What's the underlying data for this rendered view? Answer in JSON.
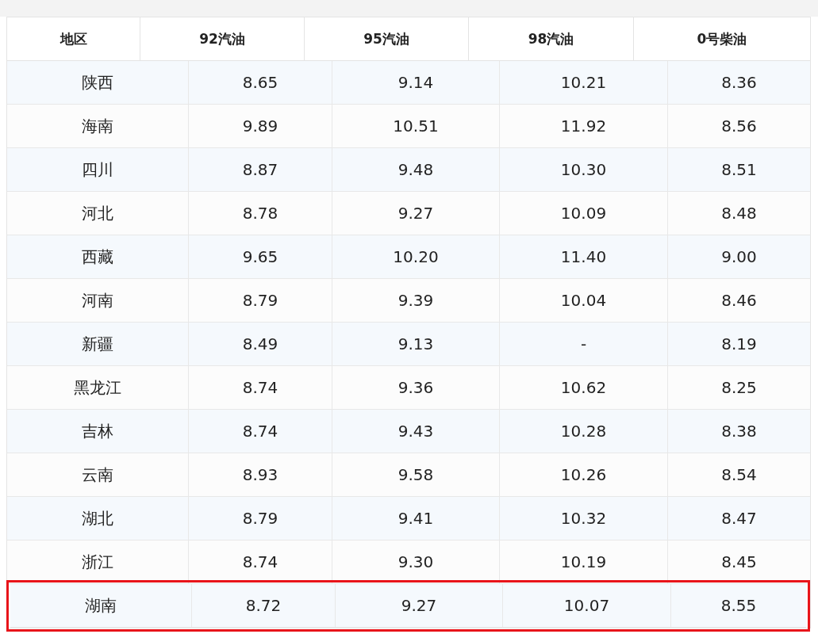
{
  "table": {
    "columns": [
      "地区",
      "92汽油",
      "95汽油",
      "98汽油",
      "0号柴油"
    ],
    "rows": [
      {
        "cells": [
          "陕西",
          "8.65",
          "9.14",
          "10.21",
          "8.36"
        ],
        "highlighted": false
      },
      {
        "cells": [
          "海南",
          "9.89",
          "10.51",
          "11.92",
          "8.56"
        ],
        "highlighted": false
      },
      {
        "cells": [
          "四川",
          "8.87",
          "9.48",
          "10.30",
          "8.51"
        ],
        "highlighted": false
      },
      {
        "cells": [
          "河北",
          "8.78",
          "9.27",
          "10.09",
          "8.48"
        ],
        "highlighted": false
      },
      {
        "cells": [
          "西藏",
          "9.65",
          "10.20",
          "11.40",
          "9.00"
        ],
        "highlighted": false
      },
      {
        "cells": [
          "河南",
          "8.79",
          "9.39",
          "10.04",
          "8.46"
        ],
        "highlighted": false
      },
      {
        "cells": [
          "新疆",
          "8.49",
          "9.13",
          "-",
          "8.19"
        ],
        "highlighted": false
      },
      {
        "cells": [
          "黑龙江",
          "8.74",
          "9.36",
          "10.62",
          "8.25"
        ],
        "highlighted": false
      },
      {
        "cells": [
          "吉林",
          "8.74",
          "9.43",
          "10.28",
          "8.38"
        ],
        "highlighted": false
      },
      {
        "cells": [
          "云南",
          "8.93",
          "9.58",
          "10.26",
          "8.54"
        ],
        "highlighted": false
      },
      {
        "cells": [
          "湖北",
          "8.79",
          "9.41",
          "10.32",
          "8.47"
        ],
        "highlighted": false
      },
      {
        "cells": [
          "浙江",
          "8.74",
          "9.30",
          "10.19",
          "8.45"
        ],
        "highlighted": false
      },
      {
        "cells": [
          "湖南",
          "8.72",
          "9.27",
          "10.07",
          "8.55"
        ],
        "highlighted": true
      }
    ]
  }
}
